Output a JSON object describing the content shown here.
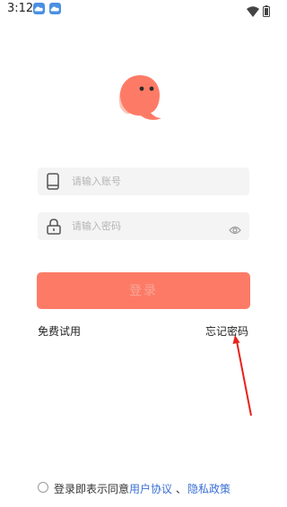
{
  "status_bar": {
    "time": "3:12",
    "icons": [
      "cloud-app-icon",
      "cloud-app-icon",
      "wifi-icon",
      "battery-icon"
    ]
  },
  "app": {
    "logo_icon": "chat-bubble-logo",
    "brand_color": "#fd7b66"
  },
  "form": {
    "account_placeholder": "请输入账号",
    "password_placeholder": "请输入密码",
    "account_value": "",
    "password_value": ""
  },
  "actions": {
    "login_label": "登录",
    "free_trial_label": "免费试用",
    "forgot_password_label": "忘记密码"
  },
  "agreement": {
    "prefix": "登录即表示同意",
    "user_agreement": "用户协议",
    "separator": "、",
    "privacy_policy": "隐私政策",
    "checked": false,
    "link_color": "#3b6fd4"
  }
}
